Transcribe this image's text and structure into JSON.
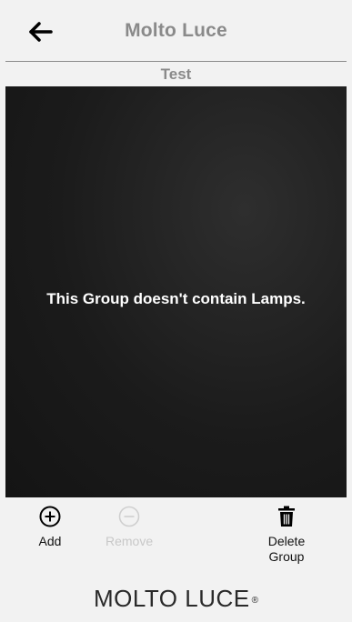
{
  "header": {
    "title": "Molto Luce",
    "back_icon": "arrow-left-icon"
  },
  "group": {
    "name": "Test",
    "empty_message": "This Group doesn't contain Lamps."
  },
  "toolbar": {
    "add_label": "Add",
    "add_icon": "plus-circle-icon",
    "remove_label": "Remove",
    "remove_icon": "minus-circle-icon",
    "remove_enabled": false,
    "delete_label": "Delete Group",
    "delete_icon": "trash-icon"
  },
  "brand": {
    "logo_text": "MOLTO LUCE",
    "registered_mark": "®"
  },
  "colors": {
    "background": "#f2f2f2",
    "header_text": "#8a8a8a",
    "content_bg": "#1b1b1b",
    "content_text": "#ffffff",
    "disabled_text": "#c8c8c8"
  }
}
